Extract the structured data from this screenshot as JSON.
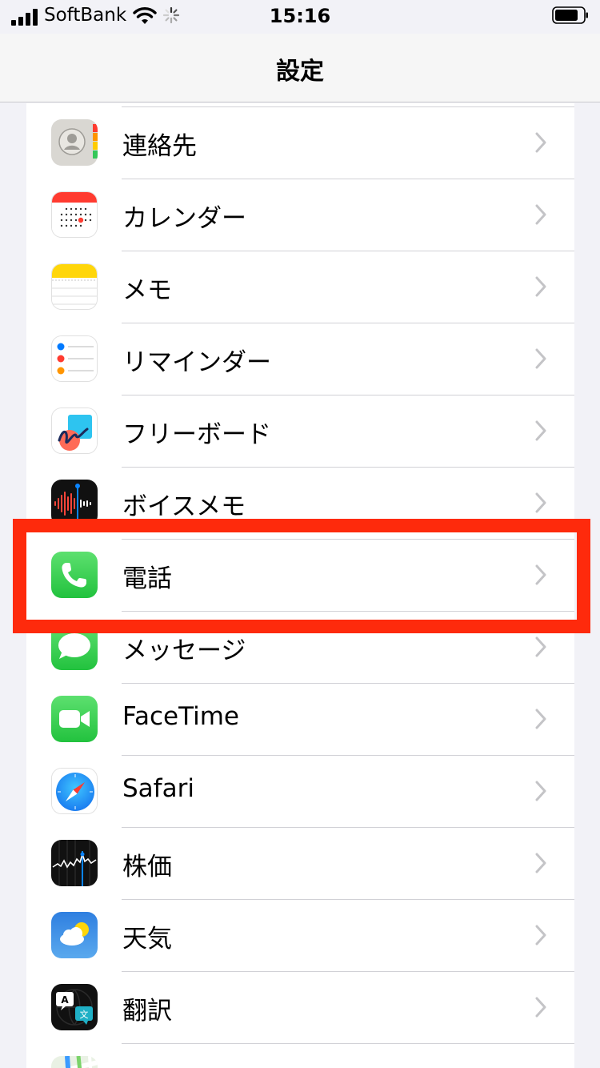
{
  "status_bar": {
    "carrier": "SoftBank",
    "time": "15:16"
  },
  "nav": {
    "title": "設定"
  },
  "settings_items": [
    {
      "label": "連絡先",
      "icon": "contacts-icon"
    },
    {
      "label": "カレンダー",
      "icon": "calendar-icon"
    },
    {
      "label": "メモ",
      "icon": "notes-icon"
    },
    {
      "label": "リマインダー",
      "icon": "reminders-icon"
    },
    {
      "label": "フリーボード",
      "icon": "freeform-icon"
    },
    {
      "label": "ボイスメモ",
      "icon": "voice-memos-icon"
    },
    {
      "label": "電話",
      "icon": "phone-icon",
      "highlighted": true
    },
    {
      "label": "メッセージ",
      "icon": "messages-icon"
    },
    {
      "label": "FaceTime",
      "icon": "facetime-icon"
    },
    {
      "label": "Safari",
      "icon": "safari-icon"
    },
    {
      "label": "株価",
      "icon": "stocks-icon"
    },
    {
      "label": "天気",
      "icon": "weather-icon"
    },
    {
      "label": "翻訳",
      "icon": "translate-icon"
    },
    {
      "label": "",
      "icon": "maps-icon"
    }
  ],
  "colors": {
    "highlight": "#fe2a0c",
    "phone_green": "#34c759",
    "background": "#f2f2f7"
  }
}
